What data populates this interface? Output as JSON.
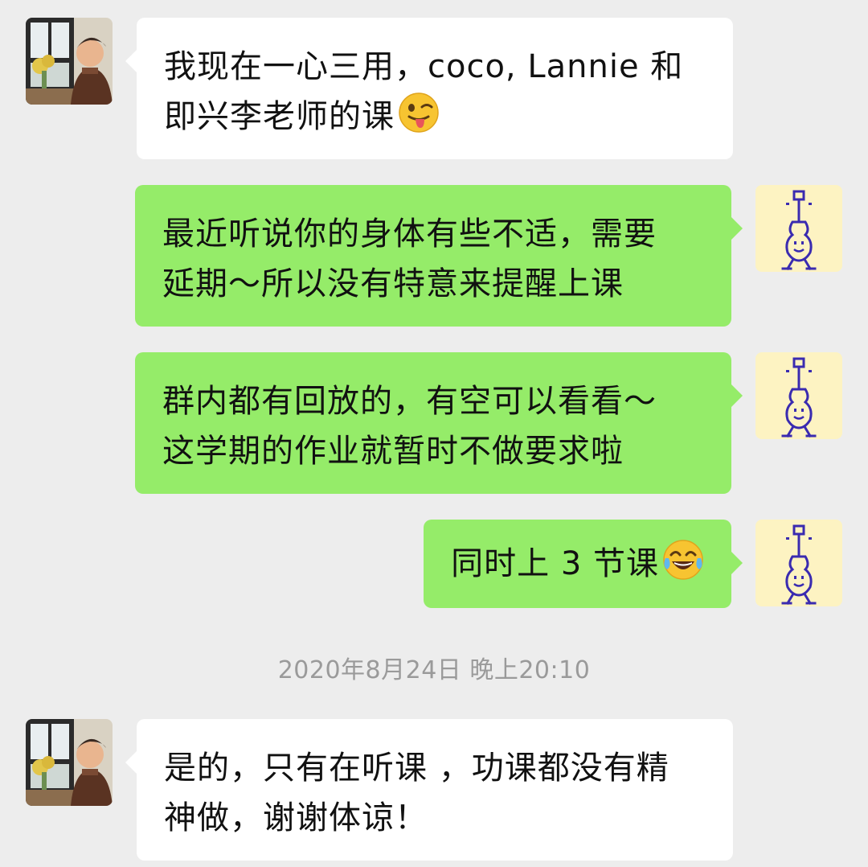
{
  "chat": {
    "messages": [
      {
        "direction": "incoming",
        "avatar_icon": "person-portrait-avatar",
        "lines": [
          "我现在一心三用，coco, Lannie 和",
          "即兴李老师的课"
        ],
        "emoji": "winking-tongue-emoji"
      },
      {
        "direction": "outgoing",
        "avatar_icon": "guitar-character-avatar",
        "lines": [
          "最近听说你的身体有些不适，需要",
          "延期～所以没有特意来提醒上课"
        ]
      },
      {
        "direction": "outgoing",
        "avatar_icon": "guitar-character-avatar",
        "lines": [
          "群内都有回放的，有空可以看看～",
          "这学期的作业就暂时不做要求啦"
        ]
      },
      {
        "direction": "outgoing",
        "avatar_icon": "guitar-character-avatar",
        "lines": [
          "同时上 3 节课"
        ],
        "emoji": "tears-of-joy-emoji"
      },
      {
        "direction": "incoming",
        "avatar_icon": "person-portrait-avatar",
        "lines": [
          "是的，只有在听课 ，功课都没有精",
          "神做，谢谢体谅！"
        ]
      }
    ],
    "timestamp": "2020年8月24日 晚上20:10"
  },
  "colors": {
    "background": "#ededed",
    "incoming_bubble": "#ffffff",
    "outgoing_bubble": "#95ec69",
    "timestamp_text": "#9a9a9a",
    "guitar_avatar_bg": "#fdf3c2",
    "guitar_avatar_ink": "#3a2bb0"
  }
}
